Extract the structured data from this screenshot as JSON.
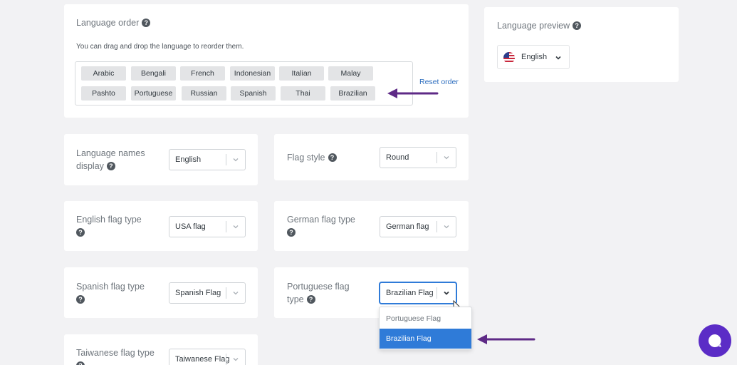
{
  "language_order": {
    "title": "Language order",
    "description": "You can drag and drop the language to reorder them.",
    "languages": [
      "Arabic",
      "Bengali",
      "French",
      "Indonesian",
      "Italian",
      "Malay",
      "Pashto",
      "Portuguese",
      "Russian",
      "Spanish",
      "Thai",
      "Brazilian"
    ],
    "reset_label": "Reset order"
  },
  "language_preview": {
    "title": "Language preview",
    "selected": "English",
    "flag_icon": "usa-flag-icon"
  },
  "settings": {
    "language_names_display": {
      "label_line1": "Language names",
      "label_line2": "display",
      "value": "English"
    },
    "flag_style": {
      "label": "Flag style",
      "value": "Round"
    },
    "english_flag_type": {
      "label": "English flag type",
      "value": "USA flag"
    },
    "german_flag_type": {
      "label": "German flag type",
      "value": "German flag"
    },
    "spanish_flag_type": {
      "label": "Spanish flag type",
      "value": "Spanish Flag"
    },
    "portuguese_flag_type": {
      "label_line1": "Portuguese flag",
      "label_line2": "type",
      "value": "Brazilian Flag",
      "options": [
        "Portuguese Flag",
        "Brazilian Flag"
      ],
      "selected_option": "Brazilian Flag"
    },
    "taiwanese_flag_type": {
      "label": "Taiwanese flag type",
      "value": "Taiwanese Flag"
    }
  },
  "colors": {
    "accent": "#2f7bd8",
    "annotation_arrow": "#5e2a86",
    "chat_button": "#5b2cc6"
  },
  "icons": {
    "help": "question-circle-icon",
    "chevron": "chevron-down-icon",
    "chat": "chat-bubble-icon"
  }
}
